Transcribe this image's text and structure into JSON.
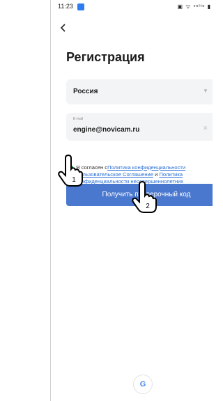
{
  "status_bar": {
    "time": "11:23",
    "right_icons": "▣ ᯤ ᵛᵒˡᵗᵉ ▮"
  },
  "page": {
    "title": "Регистрация"
  },
  "form": {
    "country_value": "Россия",
    "email_label": "E-mail",
    "email_value": "engine@novicam.ru"
  },
  "consent": {
    "prefix": "Я согласен с",
    "link1": "Политика конфиденциальности",
    "link2": "Пользовательское Соглашение",
    "and": " и ",
    "link3": "Политика",
    "link4": "конфиденциальности несовершеннолетних"
  },
  "cta": {
    "label": "Получить проверочный код"
  },
  "annotations": {
    "marker1": "1",
    "marker2": "2"
  },
  "icons": {
    "back": "back-arrow-icon",
    "google": "google-icon",
    "caret": "caret-down-icon",
    "clear": "clear-icon"
  },
  "colors": {
    "primary": "#4a78cf",
    "checkbox": "#22a05a",
    "link": "#2a6fd6"
  }
}
